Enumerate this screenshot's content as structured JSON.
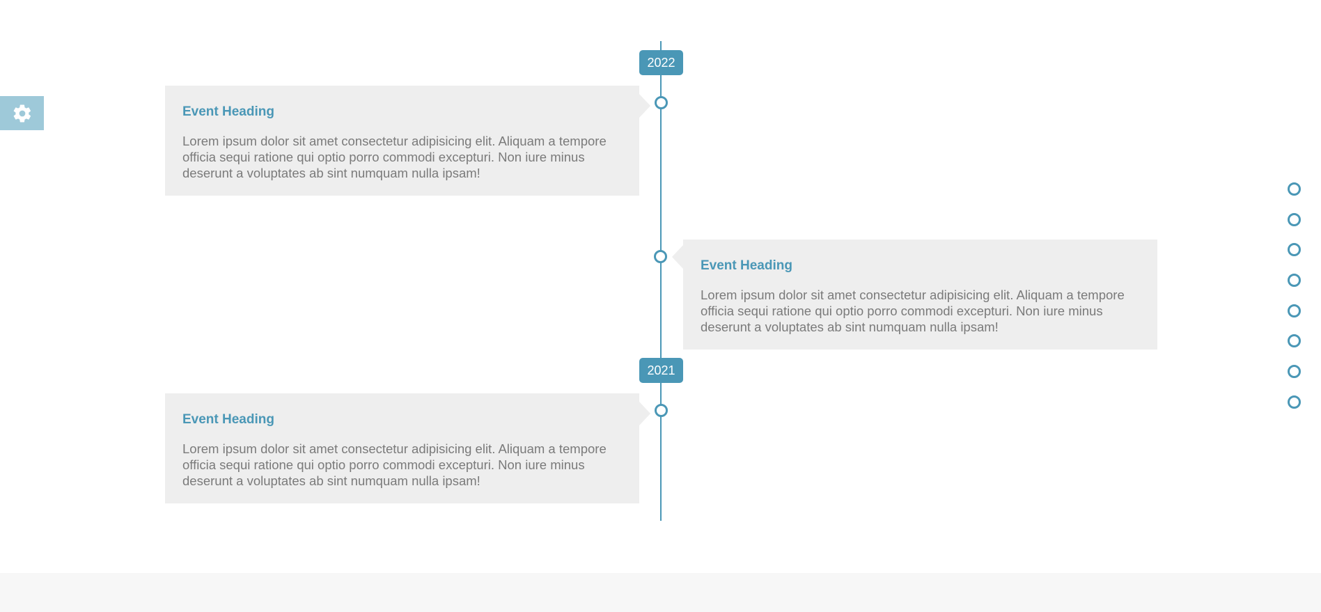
{
  "settings": {
    "icon": "gear-icon"
  },
  "timeline": {
    "years": [
      "2022",
      "2021"
    ],
    "events": [
      {
        "heading": "Event Heading",
        "text": "Lorem ipsum dolor sit amet consectetur adipisicing elit. Aliquam a tempore officia sequi ratione qui optio porro commodi excepturi. Non iure minus deserunt a voluptates ab sint numquam nulla ipsam!"
      },
      {
        "heading": "Event Heading",
        "text": "Lorem ipsum dolor sit amet consectetur adipisicing elit. Aliquam a tempore officia sequi ratione qui optio porro commodi excepturi. Non iure minus deserunt a voluptates ab sint numquam nulla ipsam!"
      },
      {
        "heading": "Event Heading",
        "text": "Lorem ipsum dolor sit amet consectetur adipisicing elit. Aliquam a tempore officia sequi ratione qui optio porro commodi excepturi. Non iure minus deserunt a voluptates ab sint numquam nulla ipsam!"
      }
    ]
  },
  "side_nav": {
    "dot_count": 8
  },
  "colors": {
    "accent": "#4a97b6",
    "settings_tab": "#9ec9d9",
    "card_bg": "#eeeeee",
    "text": "#7a7a7a",
    "footer_bg": "#f7f7f7"
  }
}
